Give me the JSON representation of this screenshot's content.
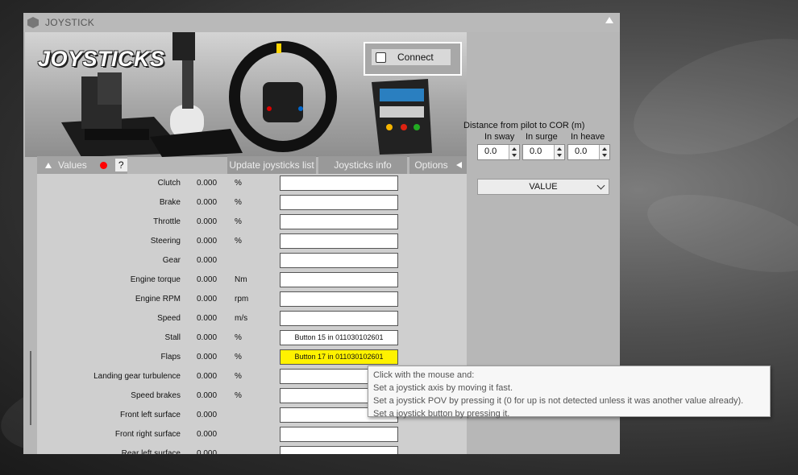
{
  "window": {
    "title": "JOYSTICK"
  },
  "banner": {
    "title": "JOYSTICKS"
  },
  "connect": {
    "label": "Connect",
    "checked": false
  },
  "tabs": {
    "values": "Values",
    "help": "?",
    "update": "Update joysticks list",
    "info": "Joysticks info",
    "options": "Options"
  },
  "rows": [
    {
      "label": "Clutch",
      "value": "0.000",
      "unit": "%",
      "binding": ""
    },
    {
      "label": "Brake",
      "value": "0.000",
      "unit": "%",
      "binding": ""
    },
    {
      "label": "Throttle",
      "value": "0.000",
      "unit": "%",
      "binding": ""
    },
    {
      "label": "Steering",
      "value": "0.000",
      "unit": "%",
      "binding": ""
    },
    {
      "label": "Gear",
      "value": "0.000",
      "unit": "",
      "binding": ""
    },
    {
      "label": "Engine torque",
      "value": "0.000",
      "unit": "Nm",
      "binding": ""
    },
    {
      "label": "Engine RPM",
      "value": "0.000",
      "unit": "rpm",
      "binding": ""
    },
    {
      "label": "Speed",
      "value": "0.000",
      "unit": "m/s",
      "binding": ""
    },
    {
      "label": "Stall",
      "value": "0.000",
      "unit": "%",
      "binding": "Button 15 in 011030102601"
    },
    {
      "label": "Flaps",
      "value": "0.000",
      "unit": "%",
      "binding": "Button 17 in 011030102601",
      "highlight": true
    },
    {
      "label": "Landing gear turbulence",
      "value": "0.000",
      "unit": "%",
      "binding": ""
    },
    {
      "label": "Speed brakes",
      "value": "0.000",
      "unit": "%",
      "binding": ""
    },
    {
      "label": "Front left surface",
      "value": "0.000",
      "unit": "",
      "binding": ""
    },
    {
      "label": "Front right surface",
      "value": "0.000",
      "unit": "",
      "binding": ""
    },
    {
      "label": "Rear left surface",
      "value": "0.000",
      "unit": "",
      "binding": ""
    }
  ],
  "cor": {
    "title": "Distance from pilot to COR (m)",
    "sway_label": "In sway",
    "surge_label": "In surge",
    "heave_label": "In heave",
    "sway": "0.0",
    "surge": "0.0",
    "heave": "0.0"
  },
  "mode_dropdown": {
    "value": "VALUE"
  },
  "tooltip": {
    "lines": [
      "Click with the mouse and:",
      "Set a joystick axis by moving it fast.",
      "Set a joystick POV by pressing it (0 for up is not detected unless it was another value already).",
      "Set a joystick button by pressing it."
    ]
  },
  "colors": {
    "highlight": "#fff200",
    "record_dot": "#ff0000"
  }
}
